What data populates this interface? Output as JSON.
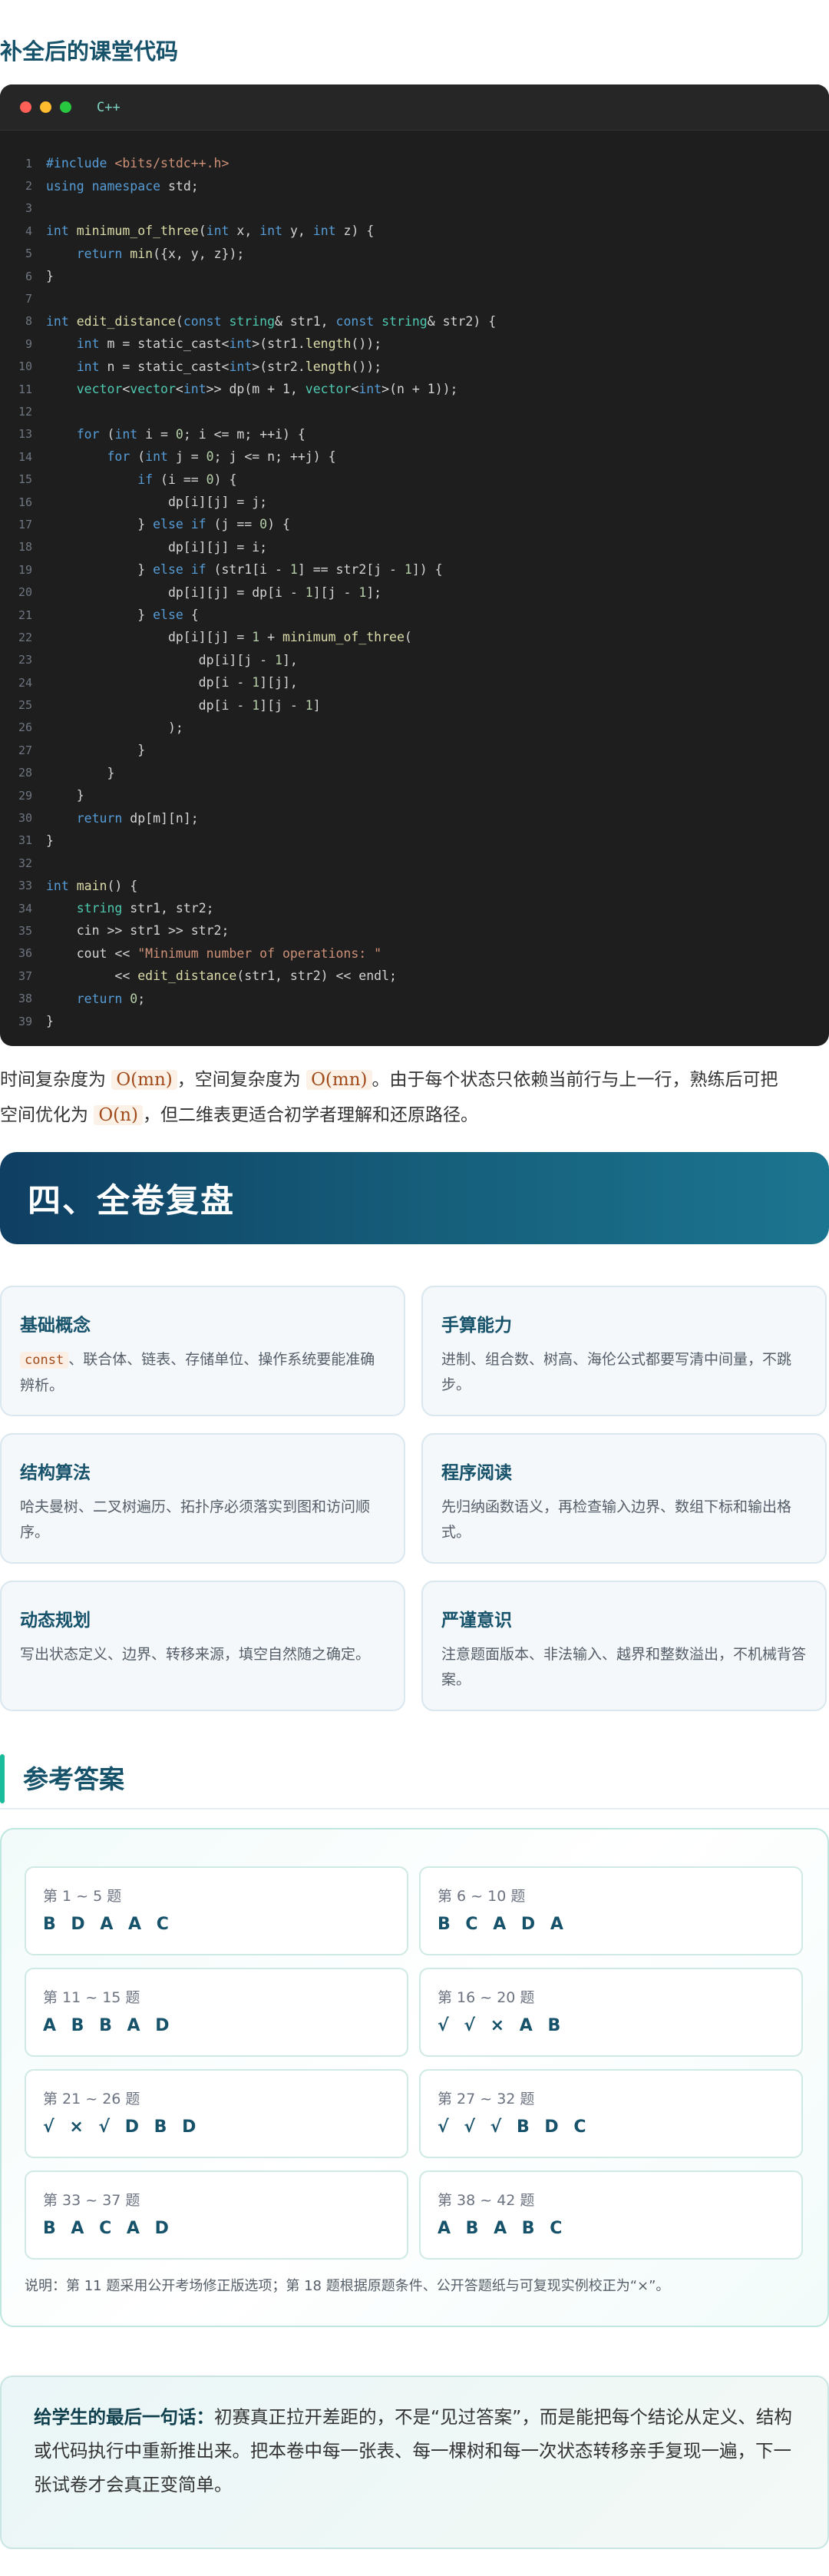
{
  "section_title": "补全后的课堂代码",
  "code": {
    "language": "C++",
    "lines": [
      [
        [
          "#include ",
          "kw"
        ],
        [
          "<bits/stdc++.h>",
          "str"
        ]
      ],
      [
        [
          "using namespace",
          "kw"
        ],
        [
          " std;",
          "pl"
        ]
      ],
      [],
      [
        [
          "int",
          "kw"
        ],
        [
          " ",
          "pl"
        ],
        [
          "minimum_of_three",
          "fn"
        ],
        [
          "(",
          "pl"
        ],
        [
          "int",
          "kw"
        ],
        [
          " x, ",
          "pl"
        ],
        [
          "int",
          "kw"
        ],
        [
          " y, ",
          "pl"
        ],
        [
          "int",
          "kw"
        ],
        [
          " z) {",
          "pl"
        ]
      ],
      [
        [
          "    ",
          "pl"
        ],
        [
          "return",
          "kw"
        ],
        [
          " ",
          "pl"
        ],
        [
          "min",
          "fn"
        ],
        [
          "({x, y, z});",
          "pl"
        ]
      ],
      [
        [
          "}",
          "pl"
        ]
      ],
      [],
      [
        [
          "int",
          "kw"
        ],
        [
          " ",
          "pl"
        ],
        [
          "edit_distance",
          "fn"
        ],
        [
          "(",
          "pl"
        ],
        [
          "const",
          "kw"
        ],
        [
          " ",
          "pl"
        ],
        [
          "string",
          "ty"
        ],
        [
          "& str1, ",
          "pl"
        ],
        [
          "const",
          "kw"
        ],
        [
          " ",
          "pl"
        ],
        [
          "string",
          "ty"
        ],
        [
          "& str2) {",
          "pl"
        ]
      ],
      [
        [
          "    ",
          "pl"
        ],
        [
          "int",
          "kw"
        ],
        [
          " m = static_cast<",
          "pl"
        ],
        [
          "int",
          "kw"
        ],
        [
          ">(str1.",
          "pl"
        ],
        [
          "length",
          "fn"
        ],
        [
          "());",
          "pl"
        ]
      ],
      [
        [
          "    ",
          "pl"
        ],
        [
          "int",
          "kw"
        ],
        [
          " n = static_cast<",
          "pl"
        ],
        [
          "int",
          "kw"
        ],
        [
          ">(str2.",
          "pl"
        ],
        [
          "length",
          "fn"
        ],
        [
          "());",
          "pl"
        ]
      ],
      [
        [
          "    ",
          "pl"
        ],
        [
          "vector",
          "ty"
        ],
        [
          "<",
          "pl"
        ],
        [
          "vector",
          "ty"
        ],
        [
          "<",
          "pl"
        ],
        [
          "int",
          "kw"
        ],
        [
          ">> dp(m + 1, ",
          "pl"
        ],
        [
          "vector",
          "ty"
        ],
        [
          "<",
          "pl"
        ],
        [
          "int",
          "kw"
        ],
        [
          ">(n + 1));",
          "pl"
        ]
      ],
      [],
      [
        [
          "    ",
          "pl"
        ],
        [
          "for",
          "kw"
        ],
        [
          " (",
          "pl"
        ],
        [
          "int",
          "kw"
        ],
        [
          " i = ",
          "pl"
        ],
        [
          "0",
          "num"
        ],
        [
          "; i <= m; ++i) {",
          "pl"
        ]
      ],
      [
        [
          "        ",
          "pl"
        ],
        [
          "for",
          "kw"
        ],
        [
          " (",
          "pl"
        ],
        [
          "int",
          "kw"
        ],
        [
          " j = ",
          "pl"
        ],
        [
          "0",
          "num"
        ],
        [
          "; j <= n; ++j) {",
          "pl"
        ]
      ],
      [
        [
          "            ",
          "pl"
        ],
        [
          "if",
          "kw"
        ],
        [
          " (i == ",
          "pl"
        ],
        [
          "0",
          "num"
        ],
        [
          ") {",
          "pl"
        ]
      ],
      [
        [
          "                dp[i][j] = j;",
          "pl"
        ]
      ],
      [
        [
          "            } ",
          "pl"
        ],
        [
          "else if",
          "kw"
        ],
        [
          " (j == ",
          "pl"
        ],
        [
          "0",
          "num"
        ],
        [
          ") {",
          "pl"
        ]
      ],
      [
        [
          "                dp[i][j] = i;",
          "pl"
        ]
      ],
      [
        [
          "            } ",
          "pl"
        ],
        [
          "else if",
          "kw"
        ],
        [
          " (str1[i - ",
          "pl"
        ],
        [
          "1",
          "num"
        ],
        [
          "] == str2[j - ",
          "pl"
        ],
        [
          "1",
          "num"
        ],
        [
          "]) {",
          "pl"
        ]
      ],
      [
        [
          "                dp[i][j] = dp[i - ",
          "pl"
        ],
        [
          "1",
          "num"
        ],
        [
          "][j - ",
          "pl"
        ],
        [
          "1",
          "num"
        ],
        [
          "];",
          "pl"
        ]
      ],
      [
        [
          "            } ",
          "pl"
        ],
        [
          "else",
          "kw"
        ],
        [
          " {",
          "pl"
        ]
      ],
      [
        [
          "                dp[i][j] = ",
          "pl"
        ],
        [
          "1",
          "num"
        ],
        [
          " + ",
          "pl"
        ],
        [
          "minimum_of_three",
          "fn"
        ],
        [
          "(",
          "pl"
        ]
      ],
      [
        [
          "                    dp[i][j - ",
          "pl"
        ],
        [
          "1",
          "num"
        ],
        [
          "],",
          "pl"
        ]
      ],
      [
        [
          "                    dp[i - ",
          "pl"
        ],
        [
          "1",
          "num"
        ],
        [
          "][j],",
          "pl"
        ]
      ],
      [
        [
          "                    dp[i - ",
          "pl"
        ],
        [
          "1",
          "num"
        ],
        [
          "][j - ",
          "pl"
        ],
        [
          "1",
          "num"
        ],
        [
          "]",
          "pl"
        ]
      ],
      [
        [
          "                );",
          "pl"
        ]
      ],
      [
        [
          "            }",
          "pl"
        ]
      ],
      [
        [
          "        }",
          "pl"
        ]
      ],
      [
        [
          "    }",
          "pl"
        ]
      ],
      [
        [
          "    ",
          "pl"
        ],
        [
          "return",
          "kw"
        ],
        [
          " dp[m][n];",
          "pl"
        ]
      ],
      [
        [
          "}",
          "pl"
        ]
      ],
      [],
      [
        [
          "int",
          "kw"
        ],
        [
          " ",
          "pl"
        ],
        [
          "main",
          "fn"
        ],
        [
          "() {",
          "pl"
        ]
      ],
      [
        [
          "    ",
          "pl"
        ],
        [
          "string",
          "ty"
        ],
        [
          " str1, str2;",
          "pl"
        ]
      ],
      [
        [
          "    cin >> str1 >> str2;",
          "pl"
        ]
      ],
      [
        [
          "    cout << ",
          "pl"
        ],
        [
          "\"Minimum number of operations: \"",
          "str"
        ]
      ],
      [
        [
          "         << ",
          "pl"
        ],
        [
          "edit_distance",
          "fn"
        ],
        [
          "(str1, str2) << endl;",
          "pl"
        ]
      ],
      [
        [
          "    ",
          "pl"
        ],
        [
          "return",
          "kw"
        ],
        [
          " ",
          "pl"
        ],
        [
          "0",
          "num"
        ],
        [
          ";",
          "pl"
        ]
      ],
      [
        [
          "}",
          "pl"
        ]
      ]
    ]
  },
  "complexity": {
    "line1": [
      {
        "t": "时间复杂度为 "
      },
      {
        "t": "O(mn)",
        "m": true
      },
      {
        "t": "，空间复杂度为 "
      },
      {
        "t": "O(mn)",
        "m": true
      },
      {
        "t": "。由于每个状态只依赖当前行与上一行，熟练后可把"
      }
    ],
    "line2": [
      {
        "t": "空间优化为 "
      },
      {
        "t": "O(n)",
        "m": true
      },
      {
        "t": "，但二维表更适合初学者理解和还原路径。"
      }
    ]
  },
  "banner_title": "四、全卷复盘",
  "review_cards": [
    {
      "title": "基础概念",
      "code": "const",
      "text": "、联合体、链表、存储单位、操作系统要能准确辨析。"
    },
    {
      "title": "手算能力",
      "code": "",
      "text": "进制、组合数、树高、海伦公式都要写清中间量，不跳步。"
    },
    {
      "title": "结构算法",
      "code": "",
      "text": "哈夫曼树、二叉树遍历、拓扑序必须落实到图和访问顺序。"
    },
    {
      "title": "程序阅读",
      "code": "",
      "text": "先归纳函数语义，再检查输入边界、数组下标和输出格式。"
    },
    {
      "title": "动态规划",
      "code": "",
      "text": "写出状态定义、边界、转移来源，填空自然随之确定。"
    },
    {
      "title": "严谨意识",
      "code": "",
      "text": "注意题面版本、非法输入、越界和整数溢出，不机械背答案。"
    }
  ],
  "answers_title": "参考答案",
  "answers": [
    {
      "label": "第 1 ~ 5 题",
      "value": "B D A A C"
    },
    {
      "label": "第 6 ~ 10 题",
      "value": "B C A D A"
    },
    {
      "label": "第 11 ~ 15 题",
      "value": "A B B A D"
    },
    {
      "label": "第 16 ~ 20 题",
      "value": "√ √ × A B"
    },
    {
      "label": "第 21 ~ 26 题",
      "value": "√ × √ D B D"
    },
    {
      "label": "第 27 ~ 32 题",
      "value": "√ √ √ B D C"
    },
    {
      "label": "第 33 ~ 37 题",
      "value": "B A C A D"
    },
    {
      "label": "第 38 ~ 42 题",
      "value": "A B A B C"
    }
  ],
  "answers_note": "说明：第 11 题采用公开考场修正版选项；第 18 题根据原题条件、公开答题纸与可复现实例校正为“×”。",
  "final_note": {
    "lead": "给学生的最后一句话：",
    "text": "初赛真正拉开差距的，不是“见过答案”，而是能把每个结论从定义、结构或代码执行中重新推出来。把本卷中每一张表、每一棵树和每一次状态转移亲手复现一遍，下一张试卷才会真正变简单。"
  },
  "colors": {
    "kw": "#569cd6",
    "fn": "#dcdcaa",
    "str": "#ce9178",
    "num": "#b5cea8",
    "ty": "#4ec9b0",
    "pl": "#d4d4d4"
  }
}
